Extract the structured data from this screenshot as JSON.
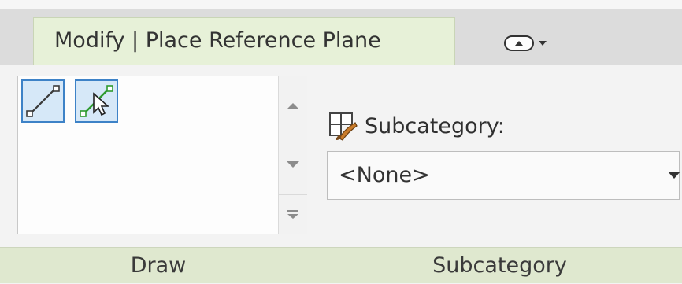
{
  "ribbon": {
    "active_tab": "Modify | Place Reference Plane",
    "toggle_icon": "panel-toggle-icon"
  },
  "draw_panel": {
    "label": "Draw",
    "tools": [
      {
        "name": "line",
        "icon": "line-icon"
      },
      {
        "name": "pick-lines",
        "icon": "pick-lines-icon"
      }
    ]
  },
  "subcategory_panel": {
    "label": "Subcategory",
    "field_label": "Subcategory:",
    "field_icon": "subcategory-icon",
    "selected_value": "<None>"
  },
  "colors": {
    "tab_active_bg": "#e7f1d8",
    "panel_footer_bg": "#dfe8cf",
    "tool_highlight_border": "#3d82c7",
    "tool_highlight_bg": "#d6e8f8"
  }
}
